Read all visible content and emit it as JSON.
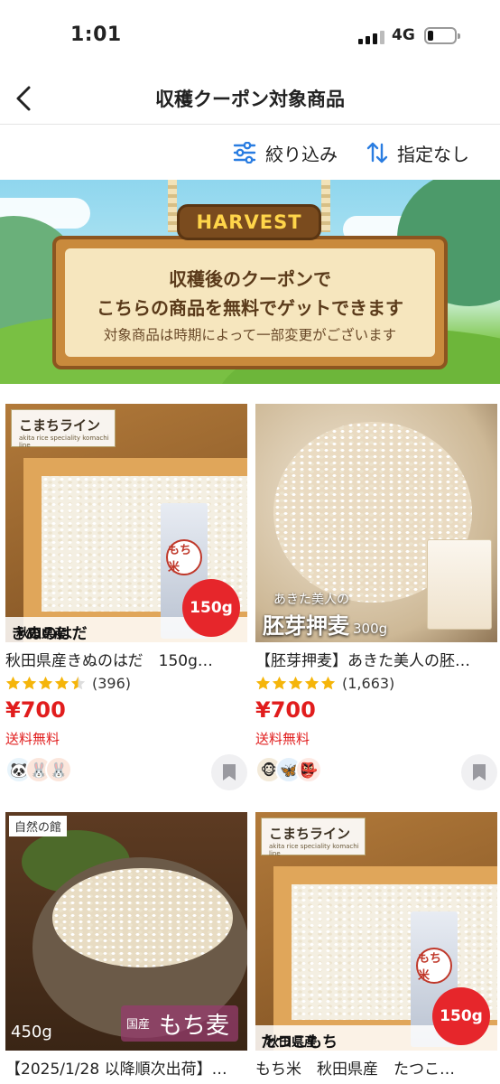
{
  "status": {
    "time": "1:01",
    "network": "4G"
  },
  "nav": {
    "title": "収穫クーポン対象商品"
  },
  "toolbar": {
    "filter_label": "絞り込み",
    "sort_label": "指定なし"
  },
  "banner": {
    "sign_label": "HARVEST",
    "line1": "収穫後のクーポンで",
    "line2": "こちらの商品を無料でゲットできます",
    "line3": "対象商品は時期によって一部変更がございます"
  },
  "products": [
    {
      "title": "秋田県産きぬのはだ　150g…",
      "rating": 4.5,
      "reviews": "(396)",
      "price": "¥700",
      "shipping": "送料無料",
      "image": {
        "brand": "こまちライン",
        "brand_sub": "akita rice speciality komachi line",
        "caption_pref": "秋田県産",
        "caption_name": "きぬのはだ",
        "weight": "150g",
        "seal": "もち米"
      }
    },
    {
      "title": "【胚芽押麦】あきた美人の胚…",
      "rating": 5,
      "reviews": "(1,663)",
      "price": "¥700",
      "shipping": "送料無料",
      "image": {
        "caption_small": "あきた美人の",
        "caption_big": "胚芽押麦",
        "weight": "300g"
      }
    },
    {
      "title": "【2025/1/28 以降順次出荷】…",
      "image": {
        "brand": "自然の館",
        "weight": "450g",
        "caption_tag": "国産",
        "caption_big": "もち麦"
      }
    },
    {
      "title": "もち米　秋田県産　たつこ…",
      "image": {
        "brand": "こまちライン",
        "brand_sub": "akita rice speciality komachi line",
        "caption_pref": "秋田県産",
        "caption_name": "たつこもち",
        "weight": "150g",
        "seal": "もち米"
      }
    }
  ],
  "colors": {
    "price": "#e11d1d",
    "accent_blue": "#2a7de1",
    "badge_red": "#e6262b"
  }
}
